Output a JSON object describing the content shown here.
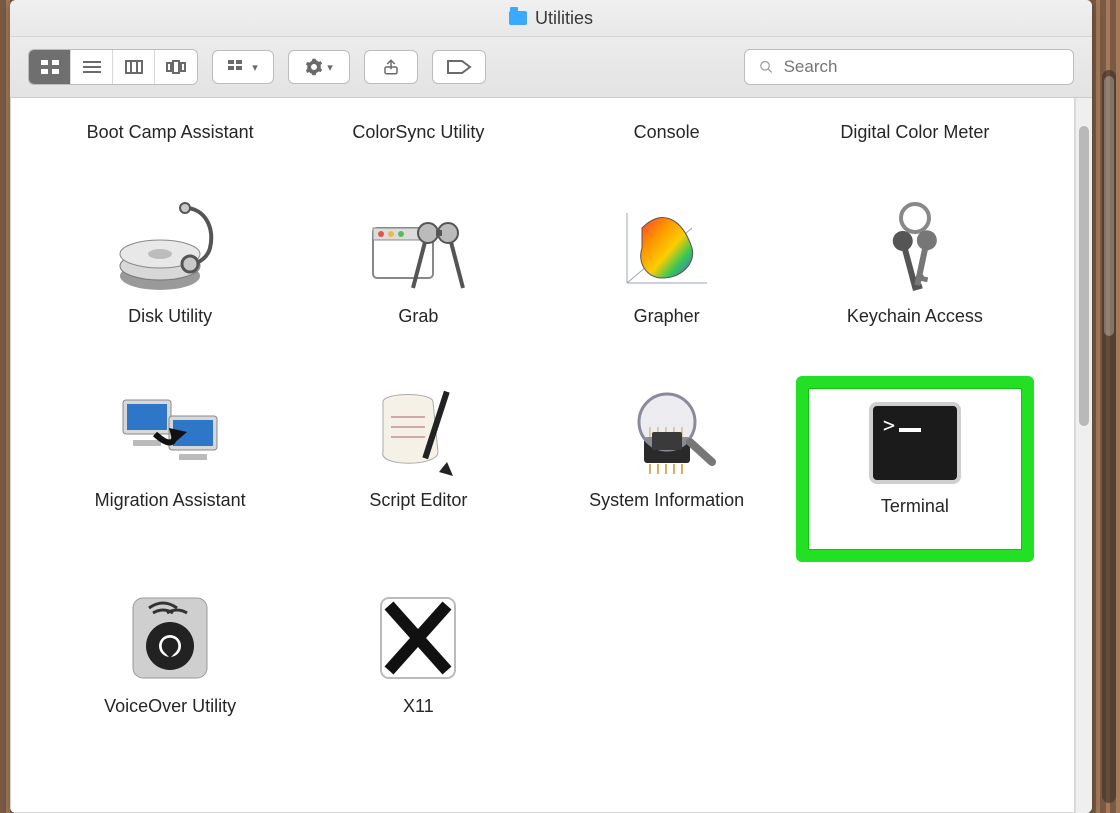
{
  "window": {
    "title": "Utilities"
  },
  "search": {
    "placeholder": "Search",
    "value": ""
  },
  "items": {
    "boot_camp": "Boot Camp Assistant",
    "colorsync": "ColorSync Utility",
    "console": "Console",
    "digital_color": "Digital Color Meter",
    "disk_utility": "Disk Utility",
    "grab": "Grab",
    "grapher": "Grapher",
    "keychain": "Keychain Access",
    "migration": "Migration Assistant",
    "script_editor": "Script Editor",
    "system_info": "System Information",
    "terminal": "Terminal",
    "voiceover": "VoiceOver Utility",
    "x11": "X11"
  },
  "highlight_item": "terminal"
}
